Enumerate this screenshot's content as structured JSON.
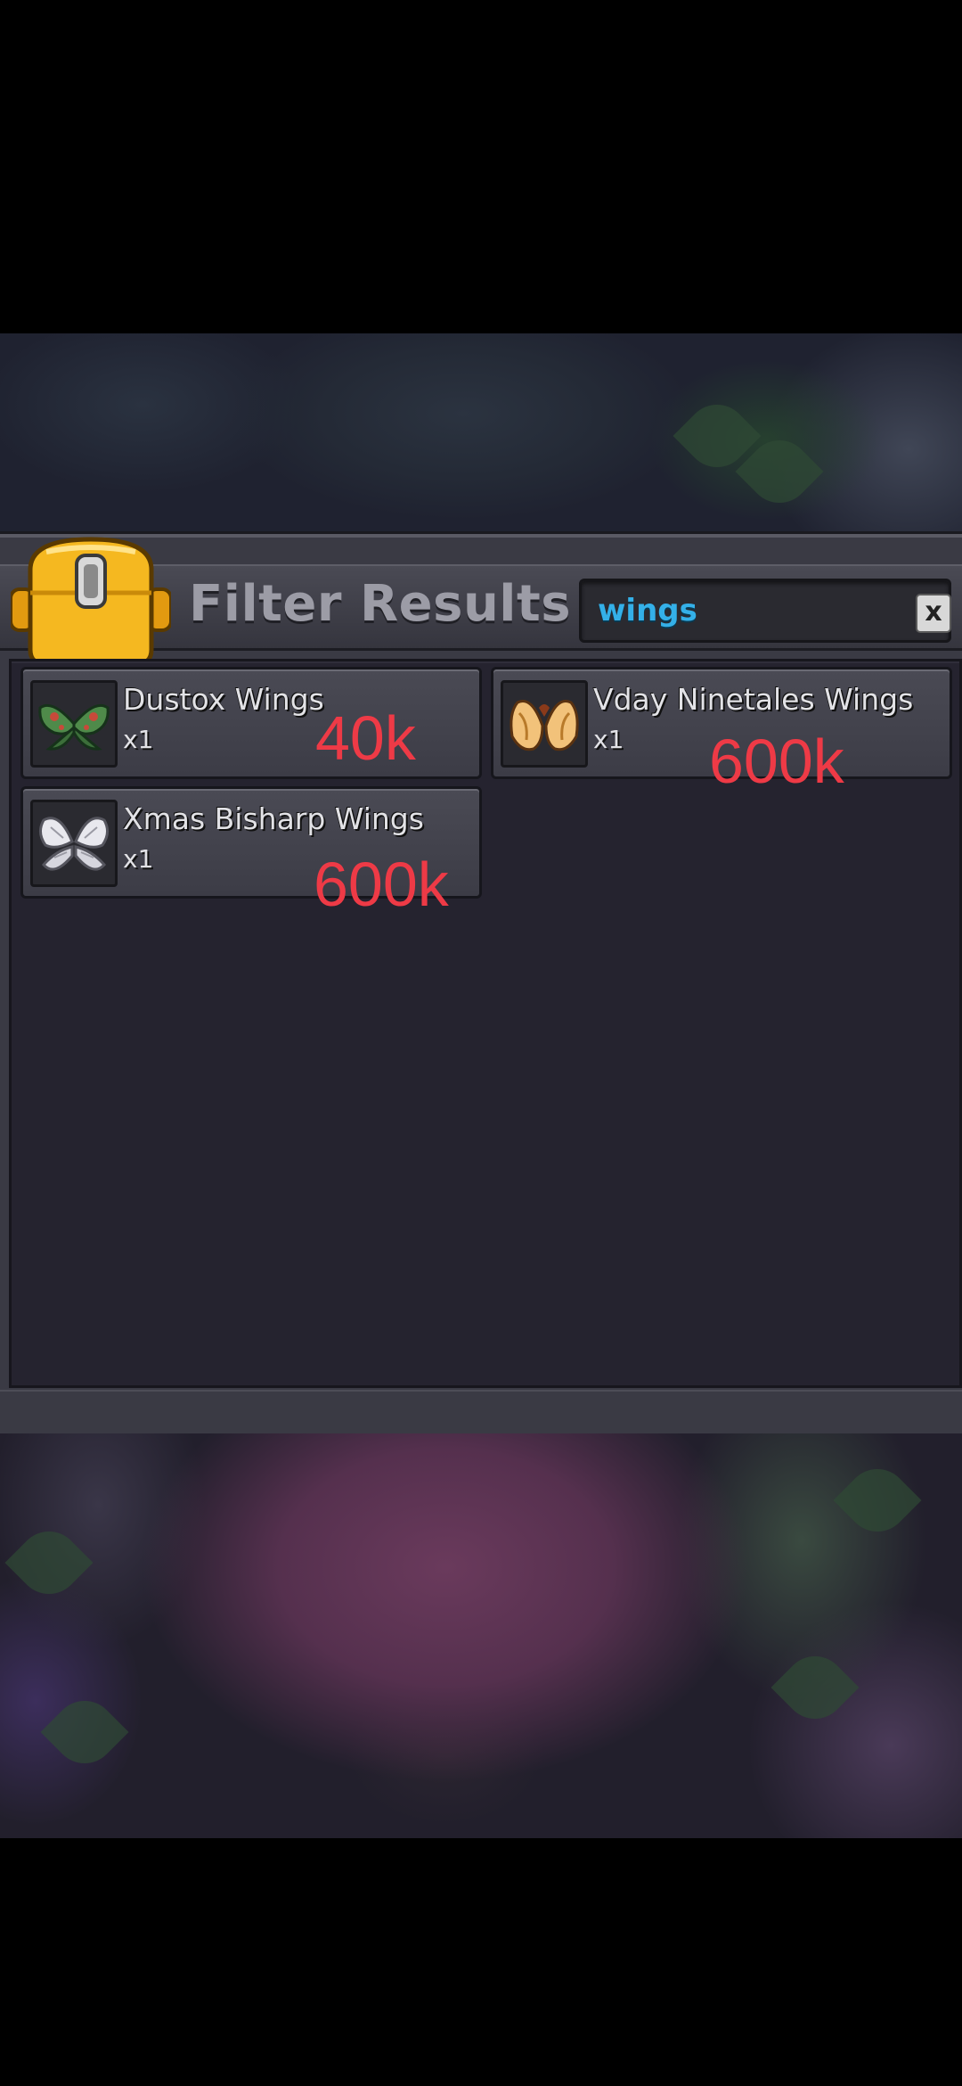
{
  "panel": {
    "title": "Filter Results",
    "search": {
      "value": "wings"
    },
    "clear_label": "x"
  },
  "items": [
    {
      "name": "Dustox Wings",
      "quantity": "x1",
      "icon": "dustox-wings-icon",
      "price_note": "40k"
    },
    {
      "name": "Vday Ninetales Wings",
      "quantity": "x1",
      "icon": "vday-ninetales-wings-icon",
      "price_note": "600k"
    },
    {
      "name": "Xmas Bisharp Wings",
      "quantity": "x1",
      "icon": "xmas-bisharp-wings-icon",
      "price_note": "600k"
    }
  ],
  "colors": {
    "search_text": "#34b0e8",
    "price_note": "#ee3a46",
    "bag_icon": "#f5b820"
  }
}
